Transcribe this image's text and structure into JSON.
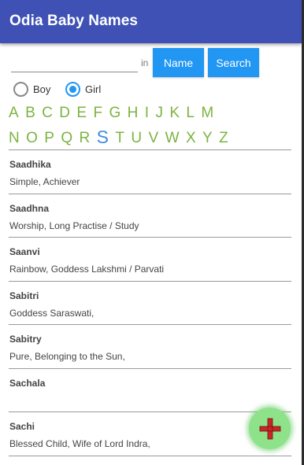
{
  "app": {
    "title": "Odia Baby Names"
  },
  "search": {
    "placeholder": "",
    "value": "",
    "in_label": "in",
    "name_button": "Name",
    "search_button": "Search"
  },
  "gender": {
    "boy": "Boy",
    "girl": "Girl",
    "selected": "Girl"
  },
  "alphabet": {
    "row1": [
      "A",
      "B",
      "C",
      "D",
      "E",
      "F",
      "G",
      "H",
      "I",
      "J",
      "K",
      "L",
      "M"
    ],
    "row2": [
      "N",
      "O",
      "P",
      "Q",
      "R",
      "S",
      "T",
      "U",
      "V",
      "W",
      "X",
      "Y",
      "Z"
    ],
    "selected": "S"
  },
  "names": [
    {
      "name": "Saadhika",
      "meaning": "Simple, Achiever"
    },
    {
      "name": "Saadhna",
      "meaning": "Worship, Long Practise / Study"
    },
    {
      "name": "Saanvi",
      "meaning": "Rainbow, Goddess Lakshmi / Parvati"
    },
    {
      "name": "Sabitri",
      "meaning": "Goddess Saraswati,"
    },
    {
      "name": "Sabitry",
      "meaning": "Pure, Belonging to the Sun,"
    },
    {
      "name": "Sachala",
      "meaning": ""
    },
    {
      "name": "Sachi",
      "meaning": "Blessed Child, Wife of Lord Indra,"
    }
  ],
  "fab": {
    "icon": "plus-icon",
    "color": "#d32f2f",
    "background": "#8ee28a"
  },
  "colors": {
    "appbar": "#3f51b5",
    "button": "#2196f3",
    "letters": "#7cb342",
    "active_letter": "#3f8ee0"
  }
}
